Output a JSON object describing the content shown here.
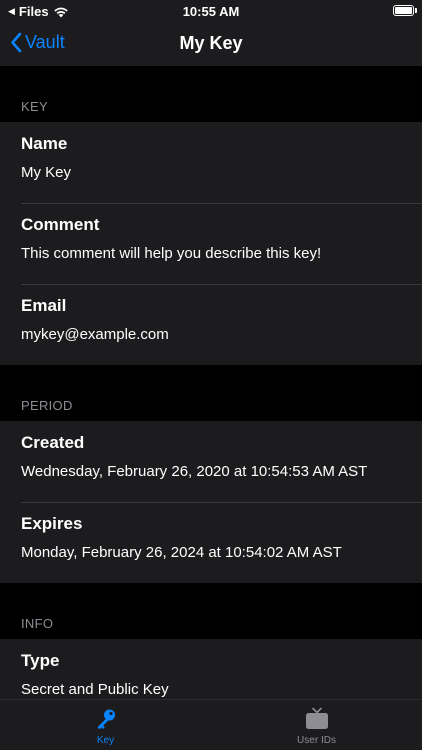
{
  "status_bar": {
    "back_app": "Files",
    "time": "10:55 AM"
  },
  "nav": {
    "back_label": "Vault",
    "title": "My Key"
  },
  "sections": [
    {
      "header": "KEY",
      "rows": [
        {
          "label": "Name",
          "value": "My Key"
        },
        {
          "label": "Comment",
          "value": "This comment will help you describe this key!"
        },
        {
          "label": "Email",
          "value": "mykey@example.com"
        }
      ]
    },
    {
      "header": "PERIOD",
      "rows": [
        {
          "label": "Created",
          "value": "Wednesday, February 26, 2020 at 10:54:53 AM AST"
        },
        {
          "label": "Expires",
          "value": "Monday, February 26, 2024 at 10:54:02 AM AST"
        }
      ]
    },
    {
      "header": "INFO",
      "rows": [
        {
          "label": "Type",
          "value": "Secret and Public Key"
        }
      ]
    }
  ],
  "tabs": [
    {
      "label": "Key",
      "icon": "key-icon",
      "active": true
    },
    {
      "label": "User IDs",
      "icon": "tv-icon",
      "active": false
    }
  ],
  "colors": {
    "accent": "#0a84ff",
    "background": "#000000",
    "cell": "#1c1c1e",
    "secondary_text": "#8d8d93"
  }
}
